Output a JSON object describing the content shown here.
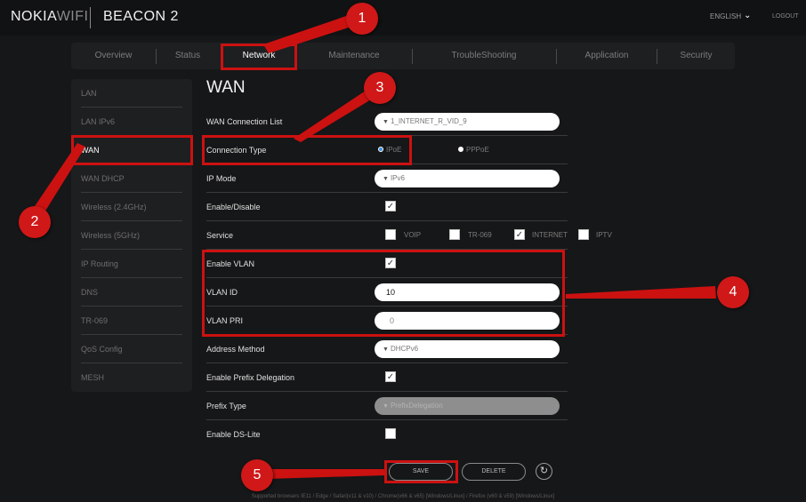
{
  "header": {
    "brand_main": "NOKIA",
    "brand_sub": "WIFI",
    "product": "BEACON 2",
    "language": "ENGLISH",
    "logout": "LOGOUT"
  },
  "tabs": [
    {
      "label": "Overview"
    },
    {
      "label": "Status"
    },
    {
      "label": "Network"
    },
    {
      "label": "Maintenance"
    },
    {
      "label": "TroubleShooting"
    },
    {
      "label": "Application"
    },
    {
      "label": "Security"
    }
  ],
  "sidebar": {
    "items": [
      {
        "label": "LAN"
      },
      {
        "label": "LAN IPv6"
      },
      {
        "label": "WAN"
      },
      {
        "label": "WAN DHCP"
      },
      {
        "label": "Wireless (2.4GHz)"
      },
      {
        "label": "Wireless (5GHz)"
      },
      {
        "label": "IP Routing"
      },
      {
        "label": "DNS"
      },
      {
        "label": "TR-069"
      },
      {
        "label": "QoS Config"
      },
      {
        "label": "MESH"
      }
    ]
  },
  "main": {
    "title": "WAN",
    "wan_connection_list": {
      "label": "WAN Connection List",
      "value": "1_INTERNET_R_VID_9"
    },
    "connection_type": {
      "label": "Connection Type",
      "option_ipoe": "IPoE",
      "option_pppoe": "PPPoE",
      "selected": "IPoE"
    },
    "ip_mode": {
      "label": "IP Mode",
      "value": "IPv6"
    },
    "enable_disable": {
      "label": "Enable/Disable",
      "checked": true
    },
    "service": {
      "label": "Service",
      "voip": "VOIP",
      "tr069": "TR-069",
      "internet": "INTERNET",
      "iptv": "IPTV"
    },
    "enable_vlan": {
      "label": "Enable VLAN",
      "checked": true
    },
    "vlan_id": {
      "label": "VLAN ID",
      "value": "10"
    },
    "vlan_pri": {
      "label": "VLAN PRI",
      "value": "0"
    },
    "address_method": {
      "label": "Address Method",
      "value": "DHCPv6"
    },
    "enable_prefix_delegation": {
      "label": "Enable Prefix Delegation",
      "checked": true
    },
    "prefix_type": {
      "label": "Prefix Type",
      "value": "PrefixDelegation"
    },
    "enable_ds_lite": {
      "label": "Enable DS-Lite",
      "checked": false
    }
  },
  "actions": {
    "save": "SAVE",
    "delete": "DELETE"
  },
  "footer": "Supported browsers IE11 / Edge / Safari(v11 & v10) / Chrome(v66 & v65) [Windows/Linux] / Firefox (v60 & v59) [Windows/Linux]",
  "annotations": {
    "badges": [
      "1",
      "2",
      "3",
      "4",
      "5"
    ],
    "highlight_color": "#cc1111"
  },
  "colors": {
    "background": "#161718",
    "panel": "#1e1f21",
    "radio_selected": "#3d8fe0",
    "annotation_red": "#d01818"
  }
}
